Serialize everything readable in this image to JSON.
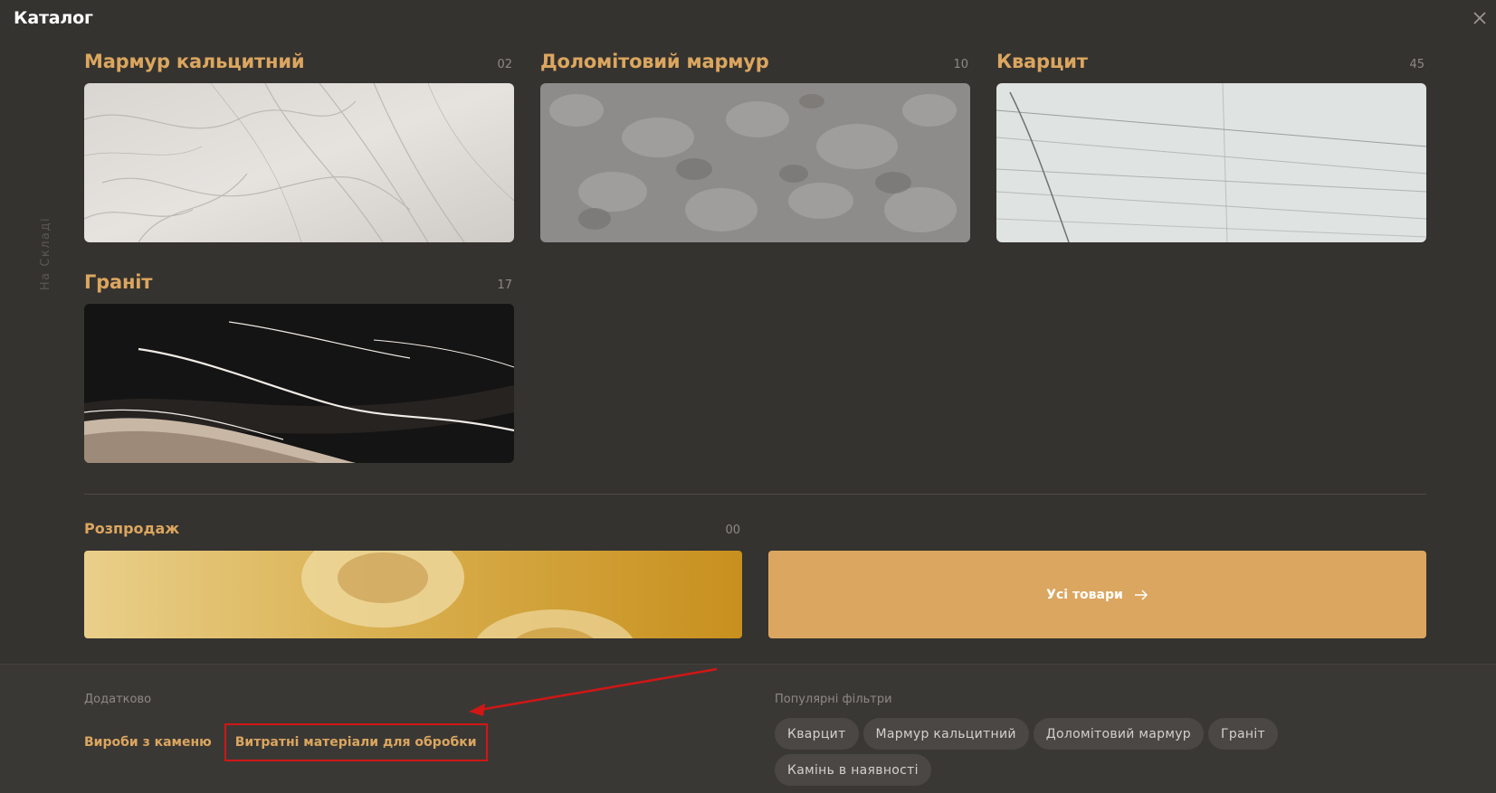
{
  "header": {
    "title": "Каталог",
    "close_icon": "close-icon"
  },
  "side_label": "На Складі",
  "categories": [
    {
      "title": "Мармур кальцитний",
      "count": "02",
      "image": "white-calcite-marble"
    },
    {
      "title": "Доломітовий мармур",
      "count": "10",
      "image": "grey-dolomite-marble"
    },
    {
      "title": "Кварцит",
      "count": "45",
      "image": "white-quartzite"
    },
    {
      "title": "Граніт",
      "count": "17",
      "image": "black-granite"
    }
  ],
  "sale": {
    "title": "Розпродаж",
    "count": "00",
    "image": "golden-stone-sale"
  },
  "all_products": {
    "label": "Усі товари",
    "icon": "arrow-right-icon"
  },
  "extra": {
    "label": "Додатково",
    "links": [
      "Вироби з каменю",
      "Витратні матеріали для обробки"
    ]
  },
  "popular": {
    "label": "Популярні фільтри",
    "chips": [
      "Кварцит",
      "Мармур кальцитний",
      "Доломітовий мармур",
      "Граніт",
      "Камінь в наявності"
    ]
  },
  "colors": {
    "accent": "#dba65f",
    "background": "#353330",
    "chip": "#4a4744",
    "annotation": "#d11616"
  }
}
